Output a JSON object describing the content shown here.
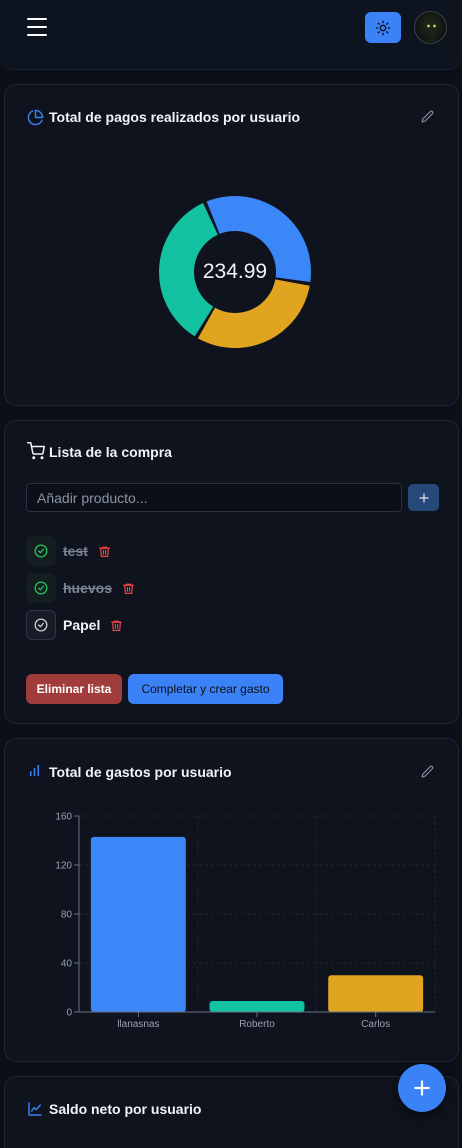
{
  "header": {
    "menu_icon": "hamburger-icon",
    "theme_icon": "sun-icon",
    "colors": {
      "accent": "#3b82f6"
    }
  },
  "payments_card": {
    "title": "Total de pagos realizados por usuario",
    "icon": "pie-chart-icon",
    "edit_icon": "pencil-icon",
    "center_value": "234.99"
  },
  "shopping_card": {
    "title": "Lista de la compra",
    "icon": "cart-icon",
    "input_placeholder": "Añadir producto...",
    "add_icon": "plus-icon",
    "items": [
      {
        "label": "test",
        "checked": true
      },
      {
        "label": "huevos",
        "checked": true
      },
      {
        "label": "Papel",
        "checked": false
      }
    ],
    "delete_button": "Eliminar lista",
    "complete_button": "Completar y crear gasto"
  },
  "expenses_card": {
    "title": "Total de gastos por usuario",
    "icon": "bar-chart-icon",
    "edit_icon": "pencil-icon"
  },
  "balance_card": {
    "title": "Saldo neto por usuario",
    "icon": "line-chart-icon"
  },
  "fab": {
    "icon": "plus-icon"
  },
  "chart_data": [
    {
      "type": "pie",
      "variant": "donut",
      "title": "",
      "center_label": "234.99",
      "slices": [
        {
          "color": "#3b87f7",
          "value": 0.34
        },
        {
          "color": "#e0a41f",
          "value": 0.31
        },
        {
          "color": "#13c2a0",
          "value": 0.35
        }
      ]
    },
    {
      "type": "bar",
      "categories": [
        "llanasnas",
        "Roberto",
        "Carlos"
      ],
      "values": [
        143,
        9,
        30
      ],
      "colors": [
        "#3b87f7",
        "#13c2a0",
        "#e0a41f"
      ],
      "ylim": [
        0,
        160
      ],
      "yticks": [
        0,
        40,
        80,
        120,
        160
      ],
      "grid": true,
      "xlabel": "",
      "ylabel": ""
    }
  ]
}
